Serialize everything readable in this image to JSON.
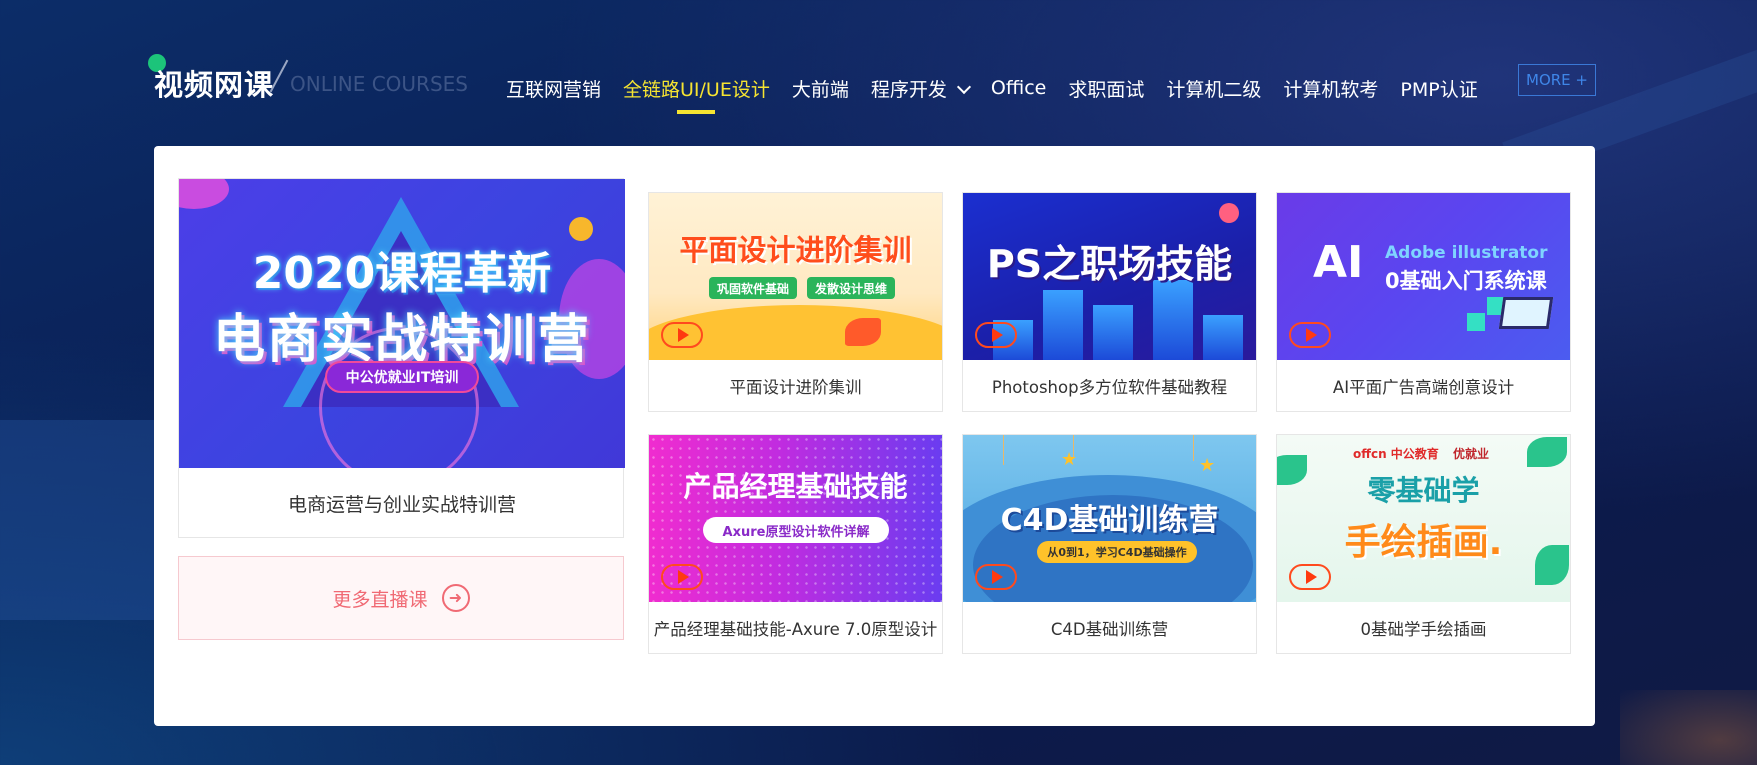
{
  "header": {
    "logo_cn": "视频网课",
    "logo_en": "ONLINE COURSES",
    "nav": [
      {
        "label": "互联网营销",
        "active": false
      },
      {
        "label": "全链路UI/UE设计",
        "active": true
      },
      {
        "label": "大前端",
        "active": false
      },
      {
        "label": "程序开发",
        "active": false,
        "dropdown": true
      },
      {
        "label": "Office",
        "active": false
      },
      {
        "label": "求职面试",
        "active": false
      },
      {
        "label": "计算机二级",
        "active": false
      },
      {
        "label": "计算机软考",
        "active": false
      },
      {
        "label": "PMP认证",
        "active": false
      }
    ],
    "more_label": "MORE +"
  },
  "featured": {
    "banner_year": "2020课程革新",
    "banner_title": "电商实战特训营",
    "banner_pill": "中公优就业IT培训",
    "caption": "电商运营与创业实战特训营"
  },
  "more_live": {
    "label": "更多直播课",
    "icon": "arrow-right-circle-icon"
  },
  "courses": [
    {
      "caption": "平面设计进阶集训",
      "banner_title": "平面设计进阶集训",
      "banner_tags": [
        "巩固软件基础",
        "发散设计思维"
      ]
    },
    {
      "caption": "Photoshop多方位软件基础教程",
      "banner_title": "PS之职场技能"
    },
    {
      "caption": "AI平面广告高端创意设计",
      "banner_title": "AI",
      "banner_line1": "Adobe illustrator",
      "banner_line2": "0基础入门系统课"
    },
    {
      "caption": "产品经理基础技能-Axure 7.0原型设计",
      "banner_title": "产品经理基础技能",
      "banner_sub": "Axure原型设计软件详解"
    },
    {
      "caption": "C4D基础训练营",
      "banner_title": "C4D基础训练营",
      "banner_sub": "从0到1，学习C4D基础操作"
    },
    {
      "caption": "0基础学手绘插画",
      "banner_brand1": "offcn 中公教育",
      "banner_brand2": "优就业",
      "banner_title1": "零基础学",
      "banner_title2": "手绘插画."
    }
  ],
  "colors": {
    "active_nav": "#f6e431",
    "more_button": "#3f86e8",
    "live_accent": "#f06a74",
    "play_icon": "#ff3a10"
  }
}
